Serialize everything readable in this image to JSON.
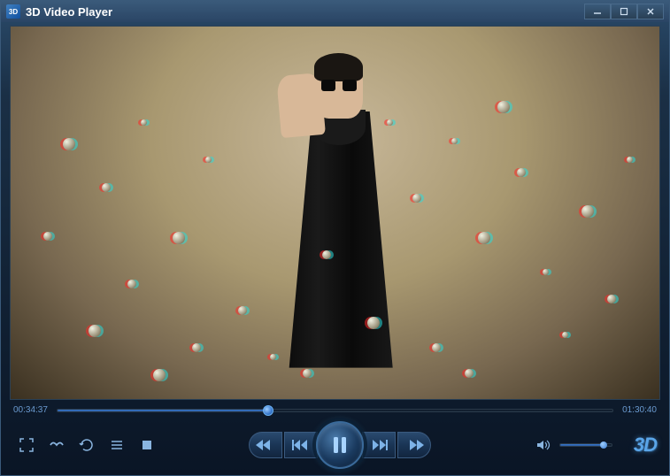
{
  "app": {
    "title": "3D Video Player",
    "icon_label": "3D"
  },
  "playback": {
    "current_time": "00:34:37",
    "total_time": "01:30:40",
    "progress_percent": 38,
    "volume_percent": 85
  },
  "controls": {
    "fullscreen_label": "fullscreen",
    "anaglyph_label": "anaglyph-mode",
    "repeat_label": "repeat",
    "playlist_label": "playlist",
    "stop_label": "stop",
    "rewind_label": "rewind",
    "prev_label": "previous",
    "play_pause_label": "pause",
    "next_label": "next",
    "fastforward_label": "fast-forward",
    "volume_label": "volume",
    "threed_label": "3D"
  },
  "colors": {
    "accent": "#5aa5e8",
    "text_time": "#6a9acf",
    "bg_dark": "#0a1525"
  }
}
